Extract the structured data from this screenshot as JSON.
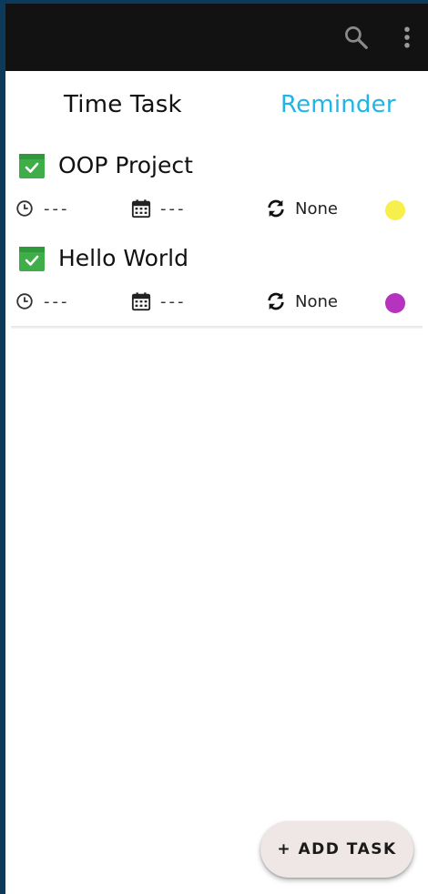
{
  "tabs": {
    "time_task": "Time Task",
    "reminder": "Reminder"
  },
  "colors": {
    "accent": "#1fb6e6",
    "appbar": "#121212",
    "check": "#3fae49"
  },
  "icons": {
    "search": "search-icon",
    "more": "more-vert-icon",
    "task": "check-box-icon",
    "time": "clock-icon",
    "date": "calendar-icon",
    "repeat": "repeat-icon"
  },
  "tasks": [
    {
      "title": "OOP Project",
      "time": "---",
      "date": "---",
      "repeat": "None",
      "color": "#f7ef4b"
    },
    {
      "title": "Hello World",
      "time": "---",
      "date": "---",
      "repeat": "None",
      "color": "#b533bf"
    }
  ],
  "fab": {
    "label": "+ ADD TASK"
  }
}
